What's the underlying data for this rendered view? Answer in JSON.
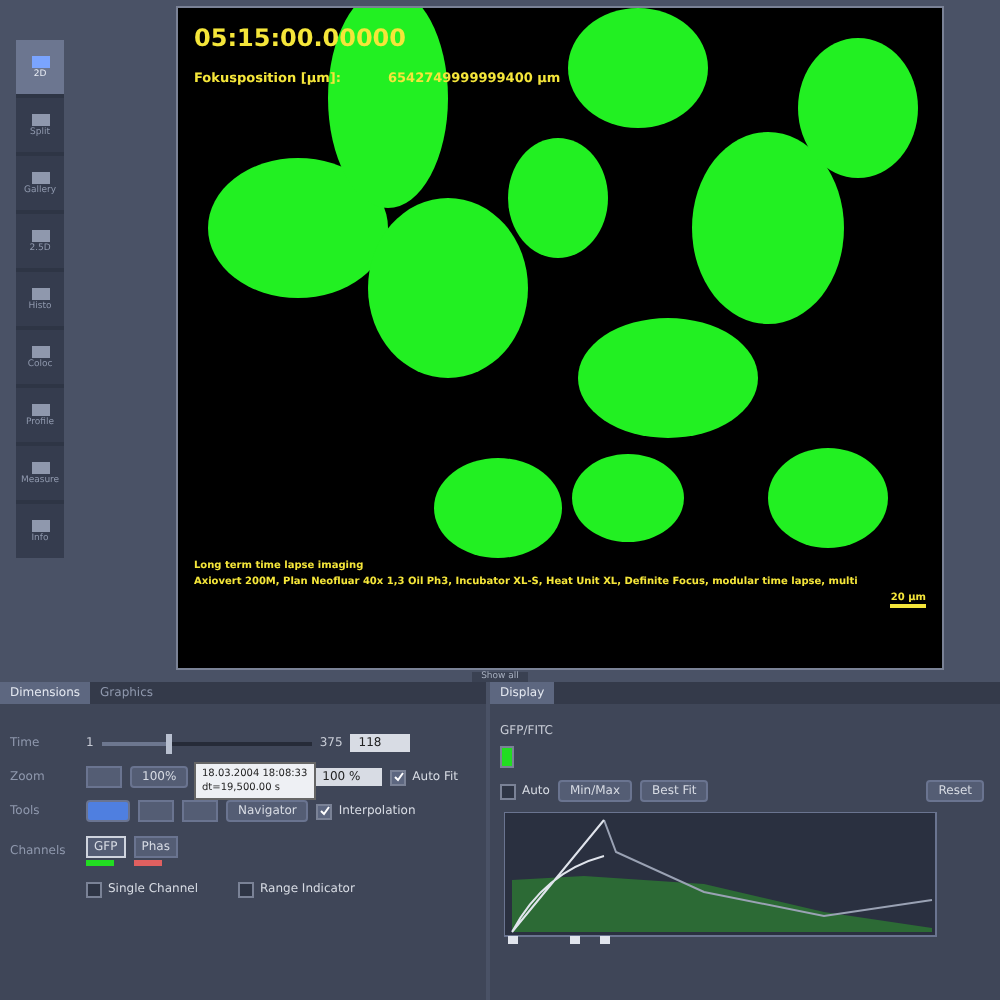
{
  "sidebar": {
    "items": [
      {
        "label": "2D",
        "selected": true
      },
      {
        "label": "Split",
        "selected": false
      },
      {
        "label": "Gallery",
        "selected": false
      },
      {
        "label": "2.5D",
        "selected": false
      },
      {
        "label": "Histo",
        "selected": false
      },
      {
        "label": "Coloc",
        "selected": false
      },
      {
        "label": "Profile",
        "selected": false
      },
      {
        "label": "Measure",
        "selected": false
      },
      {
        "label": "Info",
        "selected": false
      }
    ]
  },
  "image": {
    "timestamp": "05:15:00.00000",
    "focus_label": "Fokusposition [µm]:",
    "focus_value": "6542749999999400 µm",
    "caption_title": "Long term time lapse imaging",
    "caption_text": "Axiovert 200M, Plan Neofluar 40x 1,3 Oil Ph3, Incubator XL-S, Heat Unit XL, Definite Focus, modular time lapse, multi",
    "scale_label": "20 µm"
  },
  "splitter": {
    "label": "Show all"
  },
  "dimensions": {
    "tabs": [
      {
        "label": "Dimensions",
        "selected": true
      },
      {
        "label": "Graphics",
        "selected": false
      }
    ],
    "time": {
      "label": "Time",
      "min": "1",
      "max": "375",
      "value": "118",
      "level": 0.31
    },
    "zoom": {
      "label": "Zoom",
      "fit_button": "100%",
      "value": "100 %",
      "auto_fit": {
        "label": "Auto Fit",
        "checked": true
      }
    },
    "tooltip": [
      "18.03.2004 18:08:33",
      "dt=19,500.00 s"
    ],
    "tools": {
      "label": "Tools",
      "navigator": "Navigator",
      "interpolation": {
        "label": "Interpolation",
        "checked": true
      }
    },
    "channels": {
      "label": "Channels",
      "items": [
        {
          "label": "GFP",
          "color": "#22dd22",
          "selected": true
        },
        {
          "label": "Phas",
          "color": "#e06060",
          "selected": false
        }
      ]
    },
    "single_channel": {
      "label": "Single Channel",
      "checked": false
    },
    "range_indicator": {
      "label": "Range Indicator",
      "checked": false
    }
  },
  "display": {
    "tab": "Display",
    "channel": "GFP/FITC",
    "auto": {
      "label": "Auto",
      "checked": false
    },
    "buttons": [
      "Min/Max",
      "Best Fit"
    ],
    "reset": "Reset"
  }
}
